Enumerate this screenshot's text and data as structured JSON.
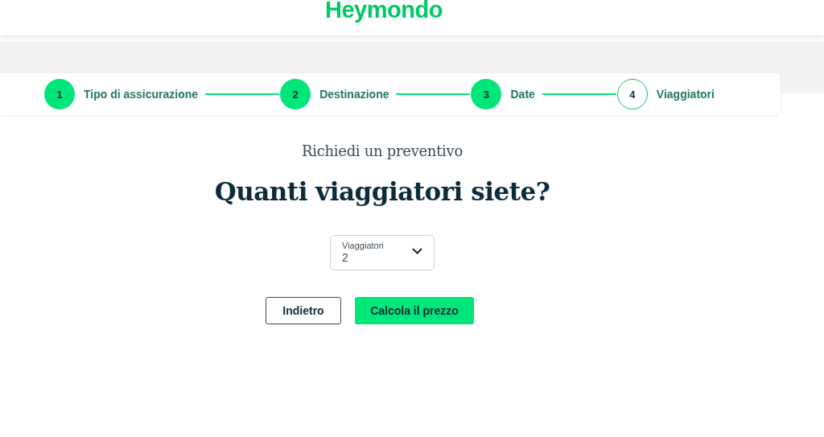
{
  "header": {
    "logo": "Heymondo"
  },
  "steps": [
    {
      "number": "1",
      "label": "Tipo di assicurazione",
      "completed": true
    },
    {
      "number": "2",
      "label": "Destinazione",
      "completed": true
    },
    {
      "number": "3",
      "label": "Date",
      "completed": true
    },
    {
      "number": "4",
      "label": "Viaggiatori",
      "completed": false
    }
  ],
  "subtitle": "Richiedi un preventivo",
  "heading": "Quanti viaggiatori siete?",
  "travelers_select": {
    "label": "Viaggiatori",
    "value": "2"
  },
  "buttons": [
    {
      "label": "Indietro",
      "kind": "secondary"
    },
    {
      "label": "Calcola il prezzo",
      "kind": "primary"
    }
  ]
}
